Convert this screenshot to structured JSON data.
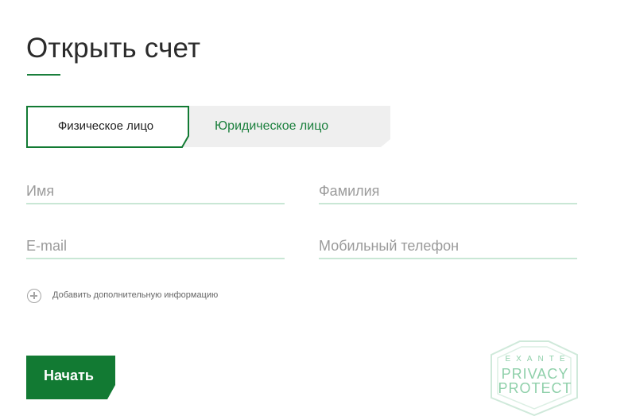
{
  "page": {
    "title": "Открыть счет"
  },
  "tabs": {
    "individual": "Физическое лицо",
    "legal": "Юридическое лицо"
  },
  "form": {
    "first_name_placeholder": "Имя",
    "last_name_placeholder": "Фамилия",
    "email_placeholder": "E-mail",
    "phone_placeholder": "Мобильный телефон",
    "add_info_label": "Добавить дополнительную информацию",
    "submit_label": "Начать"
  },
  "badge": {
    "line1": "EXANTE",
    "line2": "PRIVACY",
    "line3": "PROTECT"
  },
  "icons": {
    "add_info": "plus-circle-icon",
    "badge": "shield-icon"
  },
  "colors": {
    "accent": "#127a33",
    "tab_text": "#1a7f3c",
    "field_underline": "#c9e7d5",
    "badge": "#8fd0aa",
    "tab_inactive_bg": "#efefef"
  }
}
